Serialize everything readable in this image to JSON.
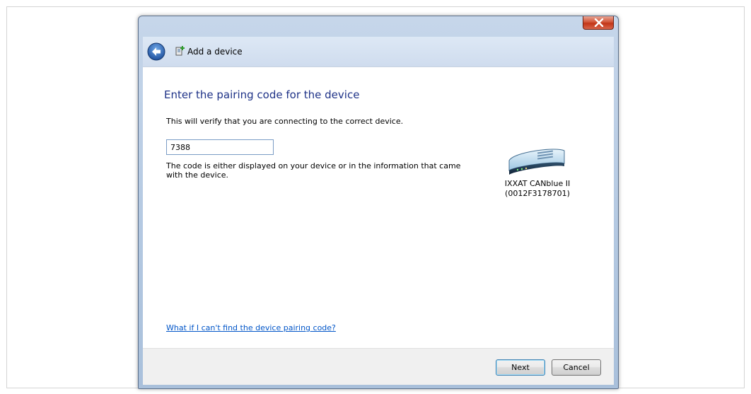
{
  "window": {
    "title": "Add a device",
    "close_tooltip": "Close"
  },
  "content": {
    "heading": "Enter the pairing code for the device",
    "subtext": "This will verify that you are connecting to the correct device.",
    "pin_value": "7388",
    "hint": "The code is either displayed on your device or in the information that came with the device.",
    "help_link": "What if I can't find the device pairing code?"
  },
  "device": {
    "name": "IXXAT CANblue II",
    "id": "(0012F3178701)",
    "icon": "network-device-icon"
  },
  "buttons": {
    "next": "Next",
    "cancel": "Cancel"
  },
  "colors": {
    "heading": "#1e3287",
    "link": "#0055c8",
    "close_button": "#c23517"
  }
}
